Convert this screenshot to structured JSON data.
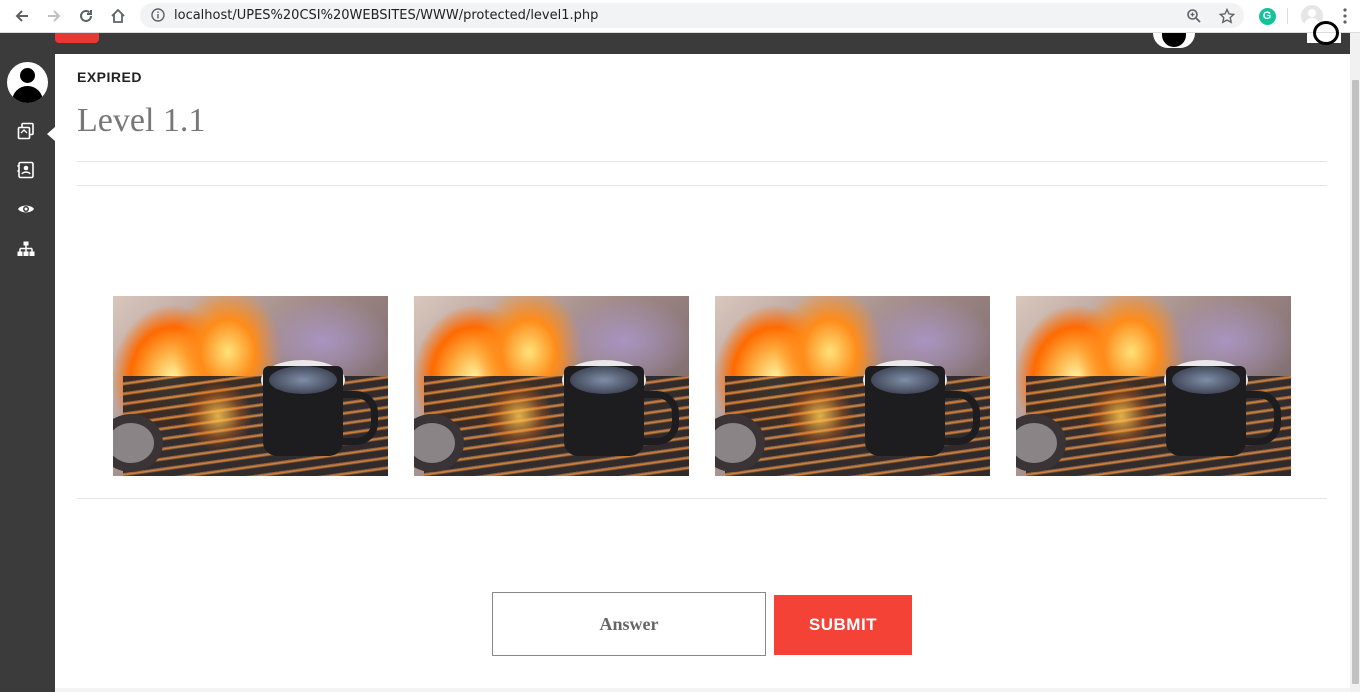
{
  "browser": {
    "url": "localhost/UPES%20CSI%20WEBSITES/WWW/protected/level1.php",
    "icons": [
      "back-arrow-icon",
      "forward-arrow-icon",
      "reload-icon",
      "home-icon",
      "info-icon",
      "zoom-icon",
      "star-icon",
      "grammarly-icon",
      "profile-icon",
      "menu-dots-icon"
    ]
  },
  "sidebar": {
    "items": [
      {
        "name": "copy-icon"
      },
      {
        "name": "contact-card-icon"
      },
      {
        "name": "eye-icon"
      },
      {
        "name": "sitemap-icon"
      }
    ]
  },
  "main": {
    "status": "EXPIRED",
    "title": "Level 1.1",
    "images": [
      "coffee-fire-image-1",
      "coffee-fire-image-2",
      "coffee-fire-image-3",
      "coffee-fire-image-4"
    ],
    "answer_placeholder": "Answer",
    "submit_label": "SUBMIT"
  },
  "colors": {
    "sidebar_bg": "#3b3b3b",
    "submit_bg": "#f44336",
    "accent_red": "#e53935"
  }
}
